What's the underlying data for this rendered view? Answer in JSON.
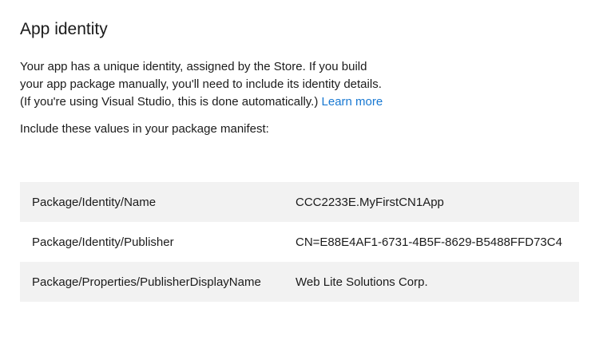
{
  "page": {
    "title": "App identity"
  },
  "intro": {
    "line1": "Your app has a unique identity, assigned by the Store. If you build",
    "line2": "your app package manually, you'll need to include its identity details.",
    "line3": "(If you're using Visual Studio, this is done automatically.)",
    "link_label": "Learn more"
  },
  "instruction": "Include these values in your package manifest:",
  "manifest_table": {
    "rows": [
      {
        "key": "Package/Identity/Name",
        "value": "CCC2233E.MyFirstCN1App"
      },
      {
        "key": "Package/Identity/Publisher",
        "value": "CN=E88E4AF1-6731-4B5F-8629-B5488FFD73C4"
      },
      {
        "key": "Package/Properties/PublisherDisplayName",
        "value": "Web Lite Solutions Corp."
      }
    ]
  },
  "colors": {
    "link": "#1778d2",
    "row_alt_bg": "#f2f2f2",
    "text": "#1b1b1b",
    "background": "#ffffff"
  }
}
